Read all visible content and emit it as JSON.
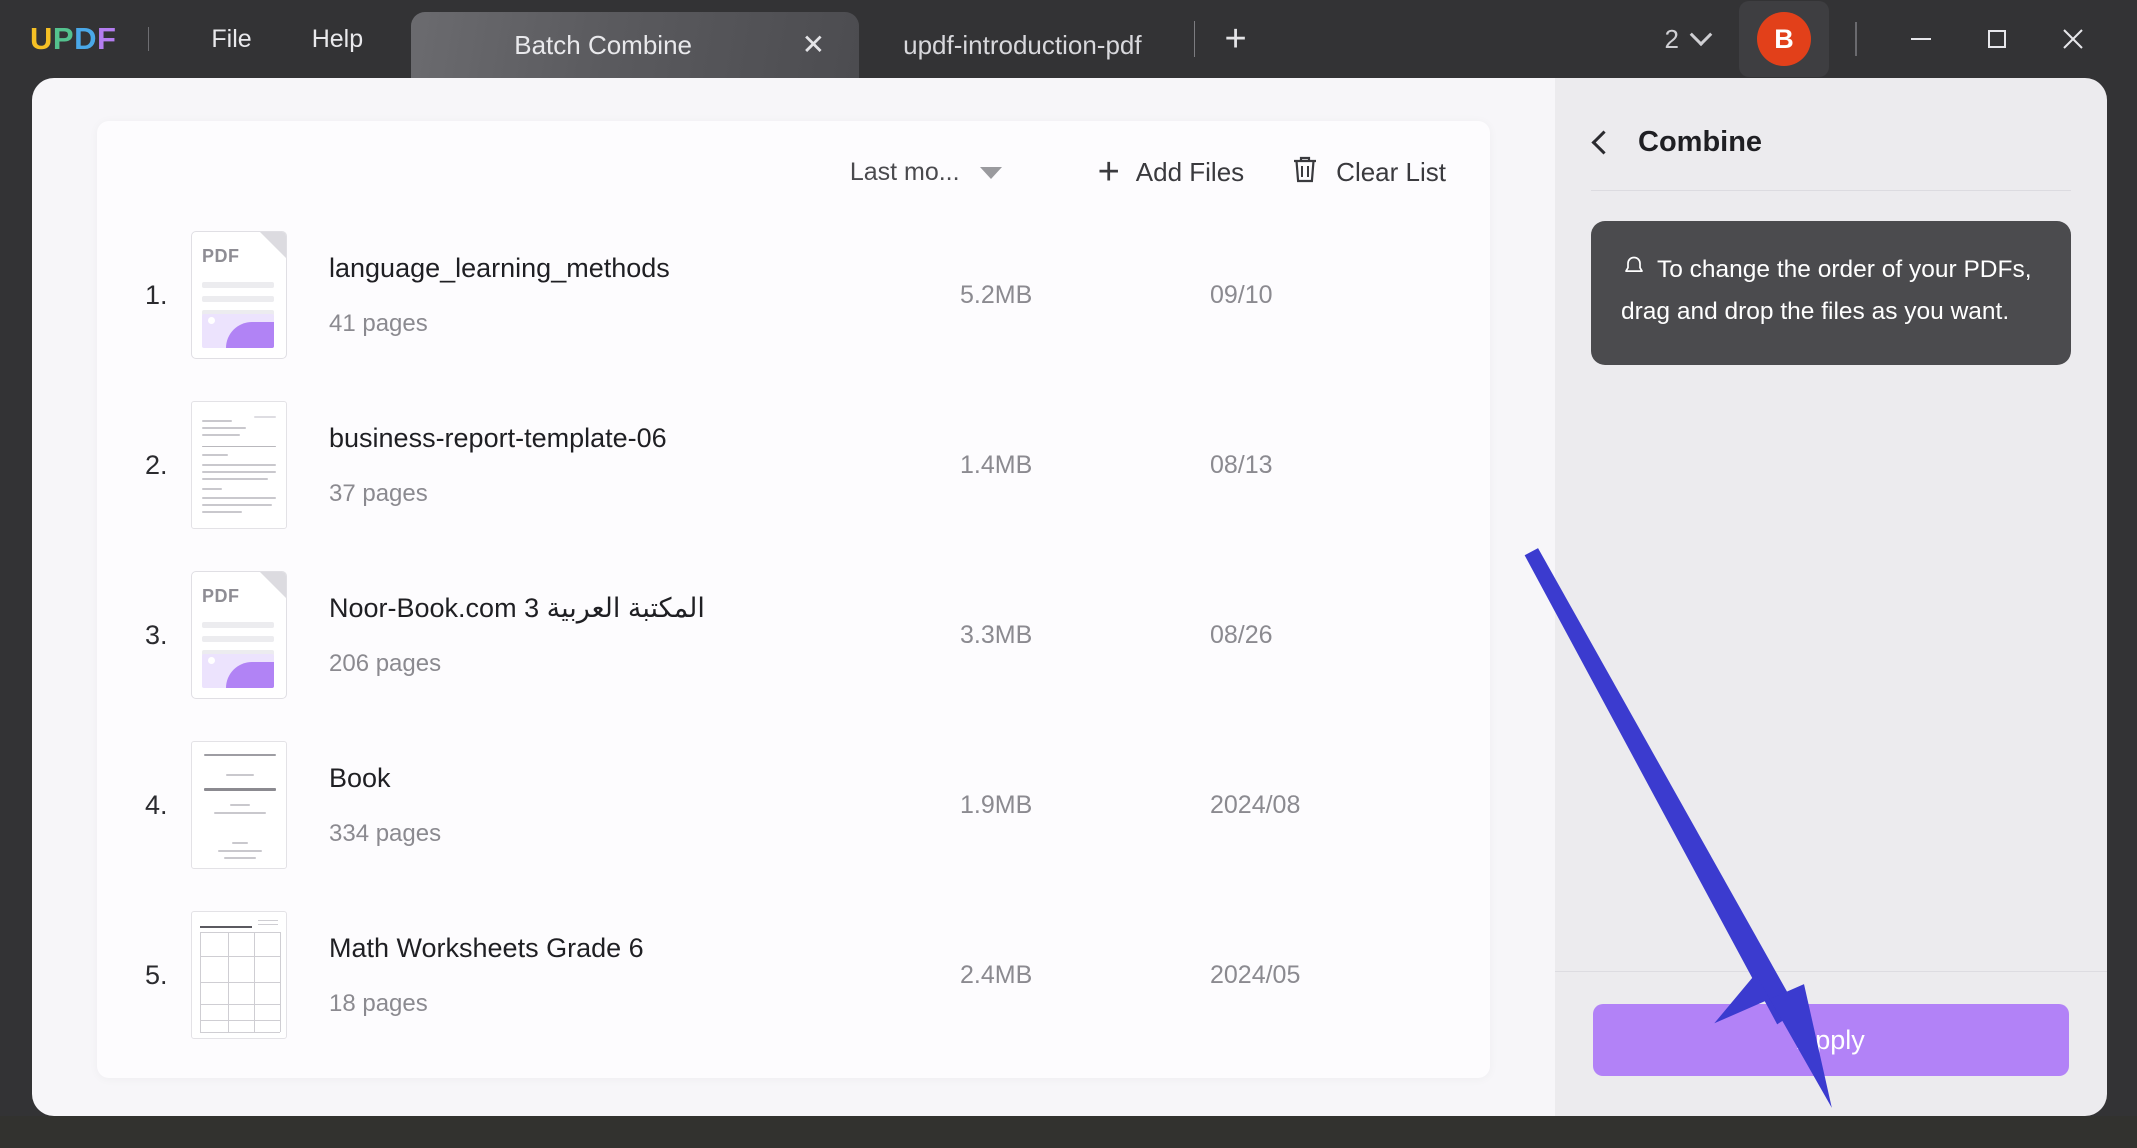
{
  "window": {
    "logo": {
      "l1": "U",
      "l2": "P",
      "l3": "D",
      "l4": "F"
    },
    "menu": [
      {
        "label": "File"
      },
      {
        "label": "Help"
      }
    ],
    "tabs": [
      {
        "label": "Batch Combine",
        "active": true,
        "close": "✕"
      },
      {
        "label": "updf-introduction-pdf",
        "active": false
      }
    ],
    "new_tab_icon": "+",
    "tab_count": "2",
    "avatar_initial": "B",
    "controls": {
      "minimize": "minimize-icon",
      "maximize": "maximize-icon",
      "close": "close-icon"
    }
  },
  "toolbar": {
    "sort_label": "Last mo...",
    "add_files_label": "Add Files",
    "add_files_icon": "+",
    "clear_list_label": "Clear List",
    "clear_list_icon": "trash-icon"
  },
  "files": [
    {
      "index": "1.",
      "name": "language_learning_methods",
      "pages": "41 pages",
      "size": "5.2MB",
      "date": "09/10",
      "thumb": "pdf",
      "thumb_label": "PDF"
    },
    {
      "index": "2.",
      "name": "business-report-template-06",
      "pages": "37 pages",
      "size": "1.4MB",
      "date": "08/13",
      "thumb": "doc-letter",
      "thumb_label": ""
    },
    {
      "index": "3.",
      "name": "Noor-Book.com  3 المكتبة العربية",
      "pages": "206 pages",
      "size": "3.3MB",
      "date": "08/26",
      "thumb": "pdf",
      "thumb_label": "PDF"
    },
    {
      "index": "4.",
      "name": "Book",
      "pages": "334 pages",
      "size": "1.9MB",
      "date": "2024/08",
      "thumb": "doc-title",
      "thumb_label": ""
    },
    {
      "index": "5.",
      "name": "Math Worksheets Grade 6",
      "pages": "18 pages",
      "size": "2.4MB",
      "date": "2024/05",
      "thumb": "doc-grid",
      "thumb_label": ""
    }
  ],
  "panel": {
    "back_icon": "chevron-left-icon",
    "title": "Combine",
    "tip_icon": "bell-icon",
    "tip_text": "To change the order of your PDFs, drag and drop the files as you want.",
    "apply_label": "Apply"
  },
  "annotation": {
    "arrow_color": "#3b3bcf",
    "arrow_name": "pointer-arrow-to-apply"
  },
  "colors": {
    "titlebar_bg": "#333335",
    "content_bg": "#f7f6f9",
    "panel_bg": "#ecebee",
    "card_bg": "#fdfcfe",
    "accent_purple": "#b282f7",
    "avatar_red": "#e2401a",
    "tip_bg": "#4b4b4e"
  }
}
